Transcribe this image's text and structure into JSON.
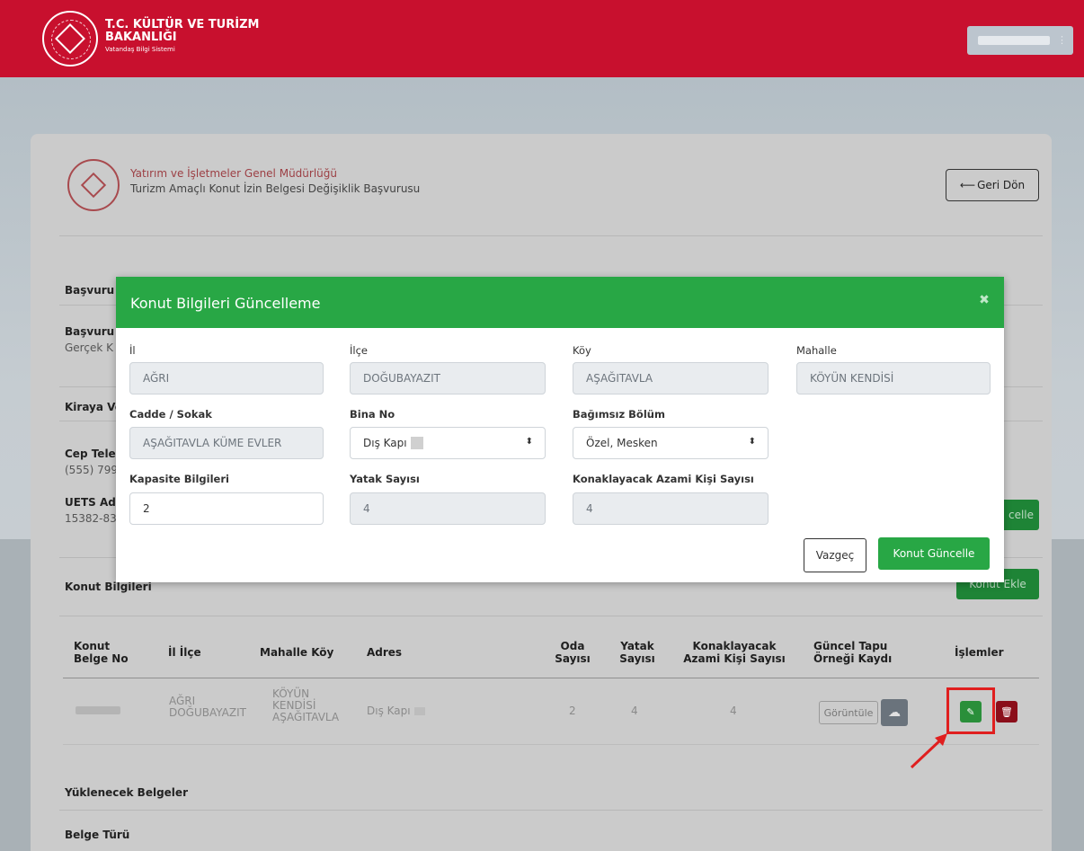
{
  "header": {
    "brand_line1": "T.C. KÜLTÜR VE TURİZM",
    "brand_line2": "BAKANLIĞI",
    "brand_line3": "Vatandaş Bilgi Sistemi",
    "user_caret": "⋮",
    "logo_icon": "ministry-emblem-icon"
  },
  "page": {
    "department": "Yatırım ve İşletmeler Genel Müdürlüğü",
    "subtitle": "Turizm Amaçlı Konut İzin Belgesi Değişiklik Başvurusu",
    "back_arrow": "⟵",
    "back_label": "Geri Dön"
  },
  "background": {
    "basvuru_header": "Başvuru",
    "basvuru_label": "Başvuru",
    "basvuru_value": "Gerçek K",
    "kiraya_header": "Kiraya Ve",
    "phone_label": "Cep Tele",
    "phone_value": "(555) 799",
    "uets_label": "UETS Adı",
    "uets_value": "15382-83",
    "update_btn": "celle",
    "konut_header": "Konut Bilgileri",
    "add_konut_btn": "Konut Ekle",
    "documents_header": "Yüklenecek Belgeler",
    "doc_type_label": "Belge Türü"
  },
  "table": {
    "columns": [
      "Konut Belge No",
      "İl İlçe",
      "Mahalle Köy",
      "Adres",
      "Oda Sayısı",
      "Yatak Sayısı",
      "Konaklayacak Azami Kişi Sayısı",
      "Güncel Tapu Örneği Kaydı",
      "İşlemler"
    ],
    "row": {
      "il_ilce": "AĞRI DOĞUBAYAZIT",
      "mahalle_koy": "KÖYÜN KENDİSİ AŞAĞITAVLA",
      "adres": "Dış Kapı",
      "oda": "2",
      "yatak": "4",
      "azami": "4",
      "view_label": "Görüntüle",
      "cloud_icon": "☁",
      "edit_icon": "✎",
      "delete_icon": "🗑"
    }
  },
  "modal": {
    "title": "Konut Bilgileri Güncelleme",
    "close": "✖",
    "fields": {
      "il_label": "İl",
      "il_value": "AĞRI",
      "ilce_label": "İlçe",
      "ilce_value": "DOĞUBAYAZIT",
      "koy_label": "Köy",
      "koy_value": "AŞAĞITAVLA",
      "mahalle_label": "Mahalle",
      "mahalle_value": "KÖYÜN KENDİSİ",
      "cadde_label": "Cadde / Sokak",
      "cadde_value": "AŞAĞITAVLA KÜME EVLER",
      "bina_label": "Bina No",
      "bina_value": "Dış Kapı",
      "bagimsiz_label": "Bağımsız Bölüm",
      "bagimsiz_value": "Özel, Mesken",
      "kapasite_label": "Kapasite Bilgileri",
      "kapasite_value": "2",
      "yatak_label": "Yatak Sayısı",
      "yatak_value": "4",
      "azami_label": "Konaklayacak Azami Kişi Sayısı",
      "azami_value": "4",
      "select_caret": "⬍"
    },
    "cancel_label": "Vazgeç",
    "submit_label": "Konut Güncelle"
  },
  "colors": {
    "brand_red": "#c8102e",
    "modal_green": "#28a745",
    "highlight_red": "#e01f1f"
  }
}
